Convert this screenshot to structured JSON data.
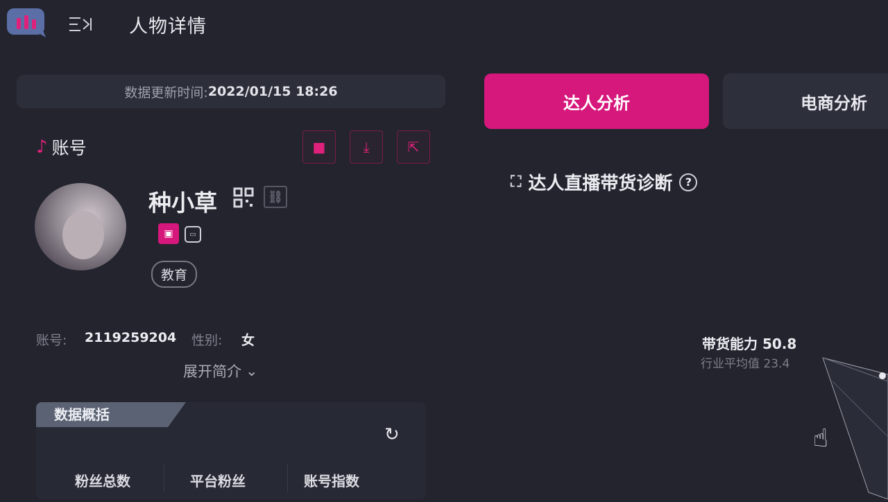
{
  "header": {
    "title": "人物详情",
    "menu_icon": "menu-icon",
    "logo_icon": "bar-chart-logo-icon"
  },
  "update": {
    "label": "数据更新时间:",
    "time": "2022/01/15 18:26"
  },
  "tabs": [
    {
      "label": "达人分析",
      "active": true
    },
    {
      "label": "电商分析",
      "active": false
    }
  ],
  "account": {
    "heading": "账号",
    "name": "种小草",
    "tag": "教育",
    "id_label": "账号:",
    "id_value": "2119259204",
    "gender_label": "性别:",
    "gender_value": "女",
    "expand_label": "展开简介"
  },
  "overview": {
    "tab_label": "数据概括",
    "metrics": [
      "粉丝总数",
      "平台粉丝",
      "账号指数"
    ]
  },
  "diagnosis": {
    "title": "达人直播带货诊断",
    "ability_label": "带货能力",
    "ability_value": "50.8",
    "avg_label": "行业平均值",
    "avg_value": "23.4"
  },
  "colors": {
    "accent": "#d6177c",
    "background": "#23242e"
  }
}
